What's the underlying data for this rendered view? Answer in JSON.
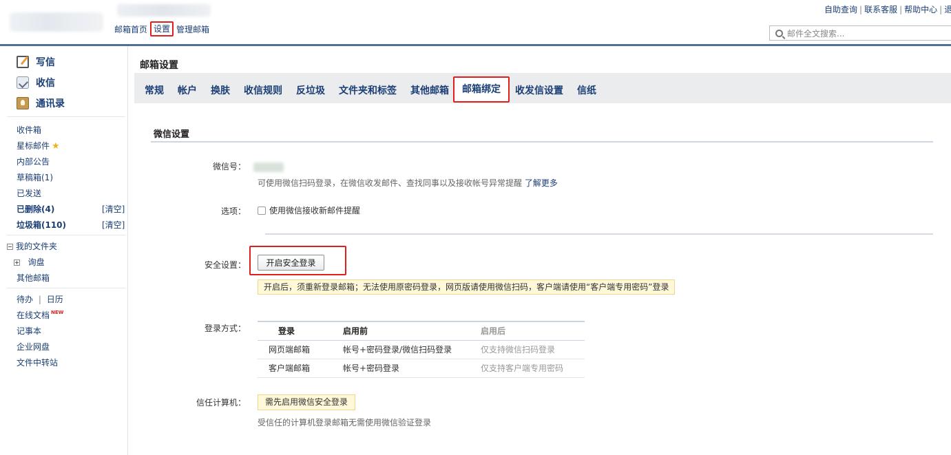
{
  "header": {
    "nav": [
      "邮箱首页",
      "设置",
      "管理邮箱"
    ],
    "toplinks": [
      "自助查询",
      "联系客服",
      "帮助中心",
      "退"
    ],
    "toplinks_sep": "|",
    "search_placeholder": "邮件全文搜索..."
  },
  "sidebar": {
    "main": [
      {
        "label": "写信",
        "icon": "write-icon"
      },
      {
        "label": "收信",
        "icon": "inbox-icon"
      },
      {
        "label": "通讯录",
        "icon": "contacts-icon"
      }
    ],
    "folders": {
      "inbox": "收件箱",
      "starred": "星标邮件",
      "announce": "内部公告",
      "drafts": "草稿箱(1)",
      "sent": "已发送",
      "deleted": "已删除(4)",
      "spam": "垃圾箱(110)",
      "clear": "[清空]"
    },
    "my_folders": "我的文件夹",
    "my_folders_sub": "询盘",
    "other_mailbox": "其他邮箱",
    "tools": {
      "todo": "待办",
      "sep": "|",
      "calendar": "日历",
      "docs": "在线文档",
      "new": "NEW",
      "notes": "记事本",
      "disk": "企业网盘",
      "transfer": "文件中转站"
    }
  },
  "main": {
    "title": "邮箱设置",
    "tabs": [
      "常规",
      "帐户",
      "换肤",
      "收信规则",
      "反垃圾",
      "文件夹和标签",
      "其他邮箱",
      "邮箱绑定",
      "收发信设置",
      "信纸"
    ],
    "active_tab": "邮箱绑定",
    "section_title": "微信设置",
    "wechat": {
      "label": "微信号：",
      "hint": "可使用微信扫码登录，在微信收发邮件、查找同事以及接收帐号异常提醒",
      "learn_more": "了解更多"
    },
    "option": {
      "label": "选项：",
      "checkbox_label": "使用微信接收新邮件提醒"
    },
    "security": {
      "label": "安全设置：",
      "button": "开启安全登录",
      "note": "开启后，须重新登录邮箱；无法使用原密码登录，网页版请使用微信扫码，客户端请使用“客户端专用密码”登录"
    },
    "login_method": {
      "label": "登录方式：",
      "headers": [
        "登录",
        "启用前",
        "启用后"
      ],
      "rows": [
        [
          "网页端邮箱",
          "帐号+密码登录/微信扫码登录",
          "仅支持微信扫码登录"
        ],
        [
          "客户端邮箱",
          "帐号+密码登录",
          "仅支持客户端专用密码"
        ]
      ]
    },
    "trusted": {
      "label": "信任计算机：",
      "badge": "需先启用微信安全登录",
      "hint": "受信任的计算机登录邮箱无需使用微信验证登录"
    }
  }
}
